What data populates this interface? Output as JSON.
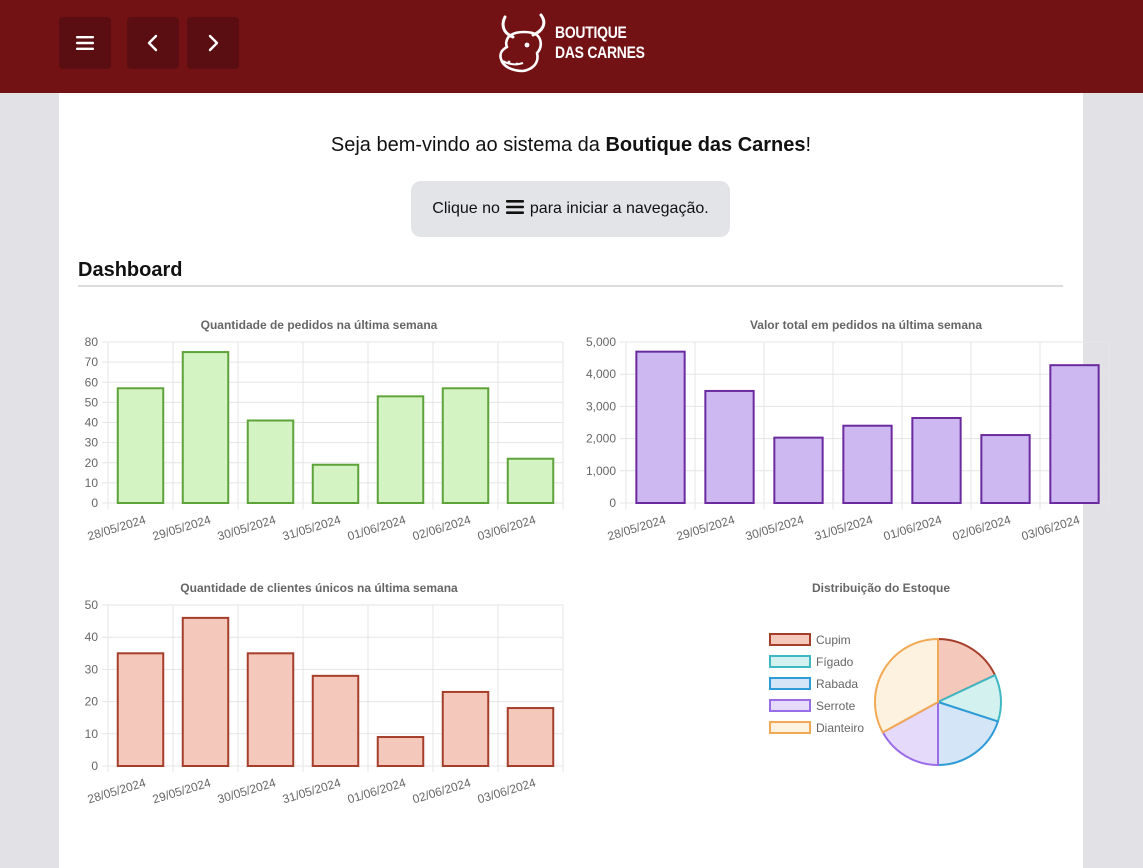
{
  "header": {
    "logo_line1": "BOUTIQUE",
    "logo_line2": "DAS CARNES",
    "menu_icon": "hamburger-icon",
    "back_icon": "chevron-left-icon",
    "forward_icon": "chevron-right-icon",
    "bar_color": "#721215"
  },
  "welcome": {
    "prefix": "Seja bem-vindo ao sistema da ",
    "brand": "Boutique das Carnes",
    "suffix": "!"
  },
  "hint": {
    "before": "Clique no",
    "after": "para iniciar a navegação."
  },
  "dashboard": {
    "title": "Dashboard"
  },
  "chart_data": [
    {
      "type": "bar",
      "title": "Quantidade de pedidos na última semana",
      "categories": [
        "28/05/2024",
        "29/05/2024",
        "30/05/2024",
        "31/05/2024",
        "01/06/2024",
        "02/06/2024",
        "03/06/2024"
      ],
      "values": [
        57,
        75,
        41,
        19,
        53,
        57,
        22
      ],
      "ylim": [
        0,
        80
      ],
      "yticks": [
        "0",
        "10",
        "20",
        "30",
        "40",
        "50",
        "60",
        "70",
        "80"
      ],
      "ytick_values": [
        0,
        10,
        20,
        30,
        40,
        50,
        60,
        70,
        80
      ],
      "fill": "#d4f3c2",
      "stroke": "#5da33a",
      "grid": true
    },
    {
      "type": "bar",
      "title": "Valor total em pedidos na última semana",
      "categories": [
        "28/05/2024",
        "29/05/2024",
        "30/05/2024",
        "31/05/2024",
        "01/06/2024",
        "02/06/2024",
        "03/06/2024"
      ],
      "values": [
        4700,
        3480,
        2030,
        2400,
        2640,
        2110,
        4280
      ],
      "ylim": [
        0,
        5000
      ],
      "yticks": [
        "0",
        "1,000",
        "2,000",
        "3,000",
        "4,000",
        "5,000"
      ],
      "ytick_values": [
        0,
        1000,
        2000,
        3000,
        4000,
        5000
      ],
      "fill": "#cdb8f1",
      "stroke": "#6b2a9e",
      "grid": true
    },
    {
      "type": "bar",
      "title": "Quantidade de clientes únicos na última semana",
      "categories": [
        "28/05/2024",
        "29/05/2024",
        "30/05/2024",
        "31/05/2024",
        "01/06/2024",
        "02/06/2024",
        "03/06/2024"
      ],
      "values": [
        35,
        46,
        35,
        28,
        9,
        23,
        18
      ],
      "ylim": [
        0,
        50
      ],
      "yticks": [
        "0",
        "10",
        "20",
        "30",
        "40",
        "50"
      ],
      "ytick_values": [
        0,
        10,
        20,
        30,
        40,
        50
      ],
      "fill": "#f5c8bc",
      "stroke": "#a53e2a",
      "grid": true
    },
    {
      "type": "pie",
      "title": "Distribuição do Estoque",
      "labels": [
        "Cupim",
        "Fígado",
        "Rabada",
        "Serrote",
        "Dianteiro"
      ],
      "values": [
        18,
        12,
        20,
        17,
        33
      ],
      "fills": [
        "#f5c8bc",
        "#d3f1ef",
        "#d3e5f7",
        "#e6dafb",
        "#fdf1df"
      ],
      "strokes": [
        "#a53e2a",
        "#3fb8c3",
        "#2e9bd6",
        "#9a6de8",
        "#f2a955"
      ],
      "legend": "left"
    }
  ]
}
